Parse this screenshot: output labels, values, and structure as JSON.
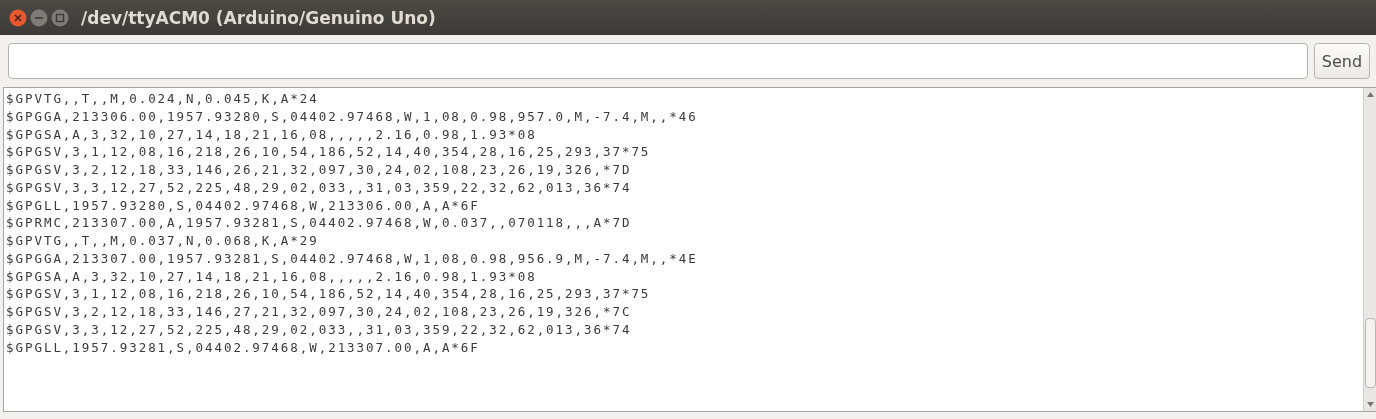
{
  "window": {
    "title": "/dev/ttyACM0 (Arduino/Genuino Uno)"
  },
  "send_button": {
    "label": "Send"
  },
  "output_lines": [
    "$GPVTG,,T,,M,0.024,N,0.045,K,A*24",
    "$GPGGA,213306.00,1957.93280,S,04402.97468,W,1,08,0.98,957.0,M,-7.4,M,,*46",
    "$GPGSA,A,3,32,10,27,14,18,21,16,08,,,,,2.16,0.98,1.93*08",
    "$GPGSV,3,1,12,08,16,218,26,10,54,186,52,14,40,354,28,16,25,293,37*75",
    "$GPGSV,3,2,12,18,33,146,26,21,32,097,30,24,02,108,23,26,19,326,*7D",
    "$GPGSV,3,3,12,27,52,225,48,29,02,033,,31,03,359,22,32,62,013,36*74",
    "$GPGLL,1957.93280,S,04402.97468,W,213306.00,A,A*6F",
    "$GPRMC,213307.00,A,1957.93281,S,04402.97468,W,0.037,,070118,,,A*7D",
    "$GPVTG,,T,,M,0.037,N,0.068,K,A*29",
    "$GPGGA,213307.00,1957.93281,S,04402.97468,W,1,08,0.98,956.9,M,-7.4,M,,*4E",
    "$GPGSA,A,3,32,10,27,14,18,21,16,08,,,,,2.16,0.98,1.93*08",
    "$GPGSV,3,1,12,08,16,218,26,10,54,186,52,14,40,354,28,16,25,293,37*75",
    "$GPGSV,3,2,12,18,33,146,27,21,32,097,30,24,02,108,23,26,19,326,*7C",
    "$GPGSV,3,3,12,27,52,225,48,29,02,033,,31,03,359,22,32,62,013,36*74",
    "$GPGLL,1957.93281,S,04402.97468,W,213307.00,A,A*6F"
  ]
}
